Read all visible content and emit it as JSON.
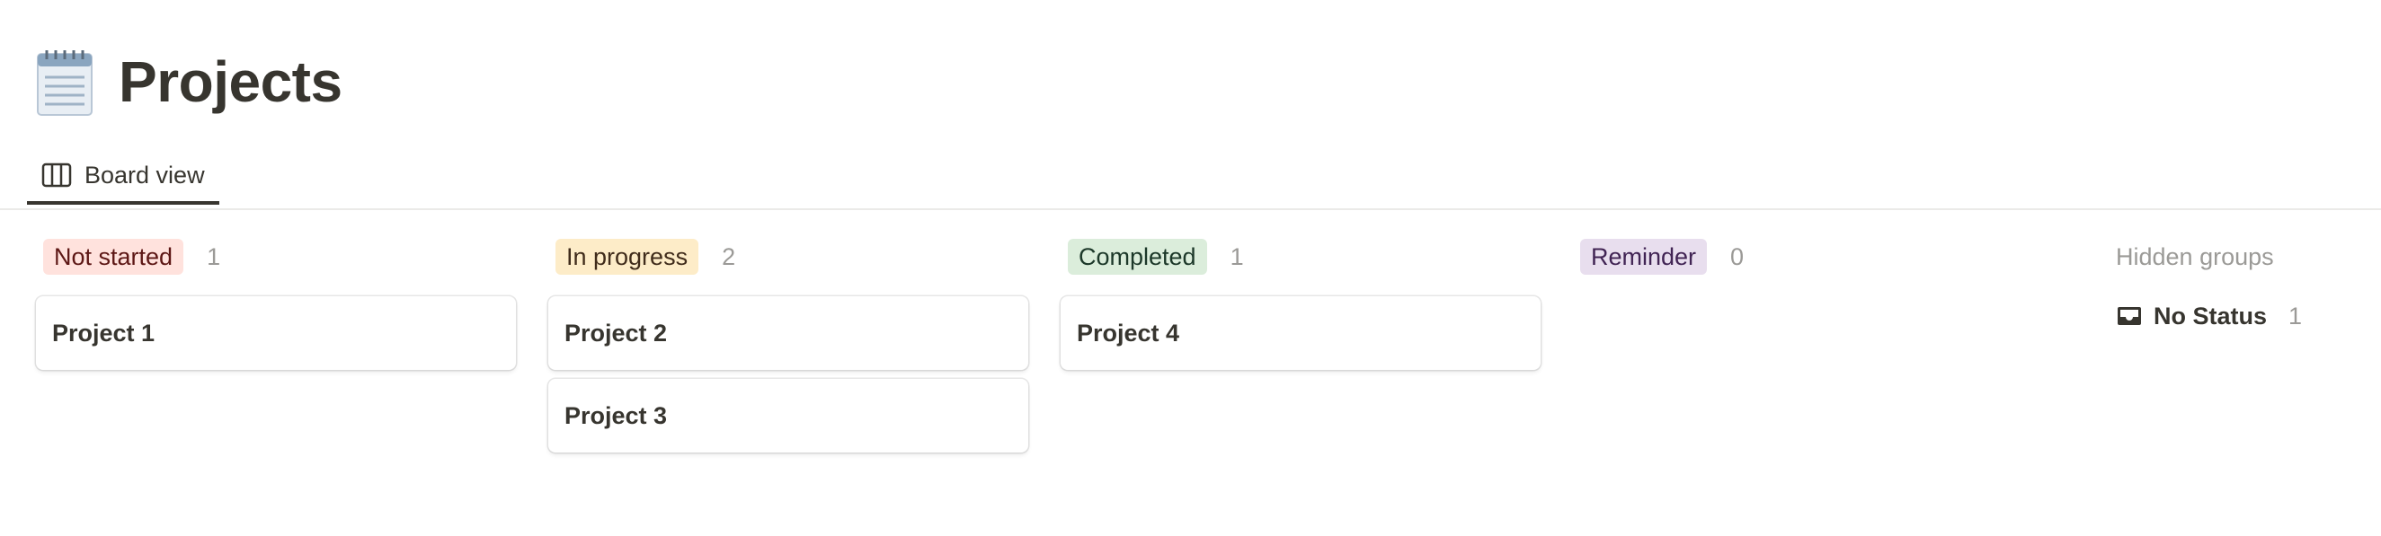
{
  "page": {
    "title": "Projects",
    "icon": "notepad-icon"
  },
  "tabs": [
    {
      "label": "Board view",
      "icon": "board-columns-icon",
      "active": true
    }
  ],
  "columns": [
    {
      "status": "Not started",
      "count": "1",
      "pill_bg": "#ffe2dd",
      "pill_fg": "#5d1715",
      "cards": [
        {
          "title": "Project 1"
        }
      ]
    },
    {
      "status": "In progress",
      "count": "2",
      "pill_bg": "#fdecc8",
      "pill_fg": "#402c1b",
      "cards": [
        {
          "title": "Project 2"
        },
        {
          "title": "Project 3"
        }
      ]
    },
    {
      "status": "Completed",
      "count": "1",
      "pill_bg": "#dbeddb",
      "pill_fg": "#1c3829",
      "cards": [
        {
          "title": "Project 4"
        }
      ]
    },
    {
      "status": "Reminder",
      "count": "0",
      "pill_bg": "#e8deee",
      "pill_fg": "#412454",
      "cards": []
    }
  ],
  "hidden_groups": {
    "title": "Hidden groups",
    "items": [
      {
        "label": "No Status",
        "count": "1",
        "icon": "inbox-icon"
      }
    ]
  }
}
